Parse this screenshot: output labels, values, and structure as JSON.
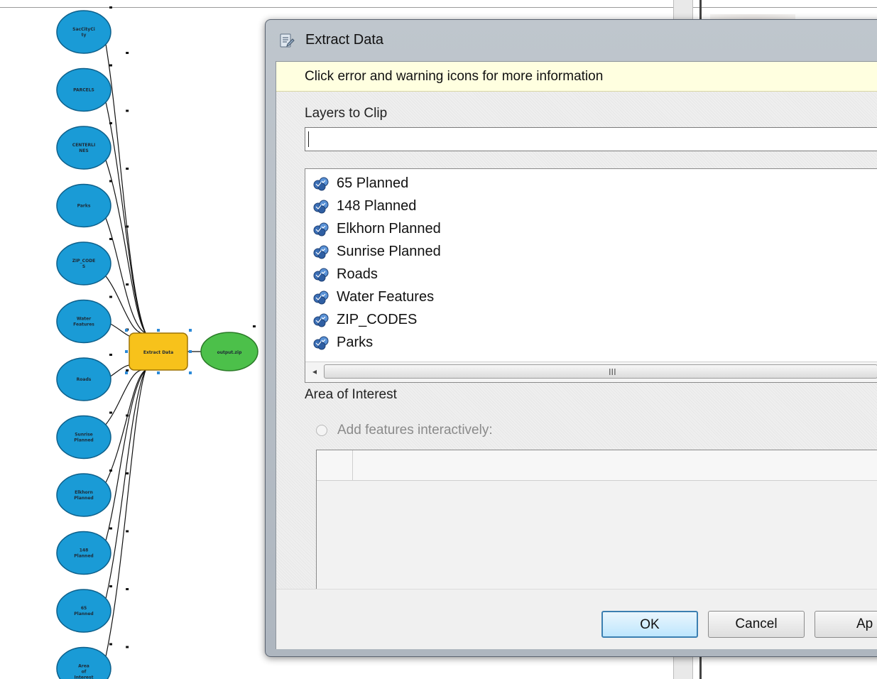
{
  "model": {
    "inputs": [
      "SacCityCi ty",
      "PARCELS",
      "CENTERLI NES",
      "Parks",
      "ZIP_CODE S",
      "Water Features",
      "Roads",
      "Sunrise Planned",
      "Elkhorn Planned",
      "148 Planned",
      "65 Planned",
      "Area of Interest"
    ],
    "tool": "Extract Data",
    "output": "output.zip"
  },
  "dialog": {
    "title": "Extract Data",
    "warning": "Click error and warning icons for more information",
    "layers_label": "Layers to Clip",
    "layers_input_value": "",
    "layers": [
      "65 Planned",
      "148 Planned",
      "Elkhorn Planned",
      "Sunrise Planned",
      "Roads",
      "Water Features",
      "ZIP_CODES",
      "Parks"
    ],
    "hscroll_grip": "III",
    "area_label": "Area of Interest",
    "add_features_label": "Add features interactively:",
    "buttons": {
      "ok": "OK",
      "cancel": "Cancel",
      "apply": "Ap"
    }
  },
  "icons": {
    "layer": "feature-layer-icon",
    "title": "tool-dialog-icon"
  },
  "colors": {
    "input_node": "#1a9bd6",
    "tool_node": "#f7c21b",
    "output_node": "#4cc04a",
    "warning_bg": "#ffffe0",
    "ok_border": "#3c7fb1"
  }
}
